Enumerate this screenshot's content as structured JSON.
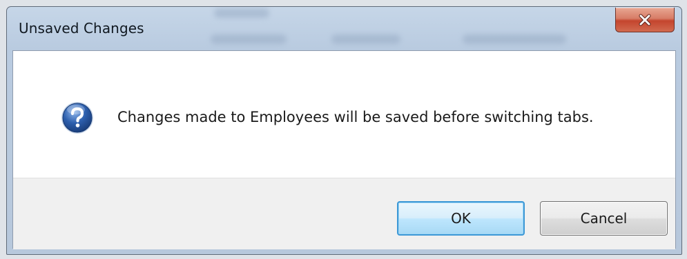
{
  "window": {
    "title": "Unsaved Changes",
    "close_icon": "close-icon"
  },
  "dialog": {
    "icon": "question-icon",
    "message": "Changes made to Employees will be saved before switching tabs."
  },
  "buttons": {
    "ok_label": "OK",
    "cancel_label": "Cancel"
  },
  "colors": {
    "close_button": "#c4452e",
    "question_icon": "#2d5fad",
    "default_button_border": "#3c98d6"
  }
}
